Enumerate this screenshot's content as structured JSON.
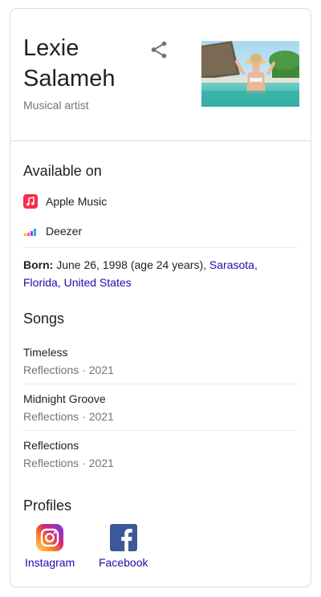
{
  "header": {
    "name": "Lexie Salameh",
    "subtitle": "Musical artist"
  },
  "available_on": {
    "title": "Available on",
    "items": [
      {
        "label": "Apple Music",
        "icon": "apple-music-icon"
      },
      {
        "label": "Deezer",
        "icon": "deezer-icon"
      }
    ]
  },
  "born": {
    "label": "Born:",
    "text": "June 26, 1998 (age 24 years),",
    "place1": "Sarasota,",
    "place2": "Florida,",
    "place3": "United States"
  },
  "songs": {
    "title": "Songs",
    "items": [
      {
        "title": "Timeless",
        "meta": "Reflections · 2021"
      },
      {
        "title": "Midnight Groove",
        "meta": "Reflections · 2021"
      },
      {
        "title": "Reflections",
        "meta": "Reflections · 2021"
      }
    ]
  },
  "profiles": {
    "title": "Profiles",
    "items": [
      {
        "label": "Instagram",
        "icon": "instagram-icon"
      },
      {
        "label": "Facebook",
        "icon": "facebook-icon"
      }
    ]
  },
  "colors": {
    "link": "#1a0dab",
    "muted": "#70757a",
    "apple_music": "#fa2d48",
    "facebook": "#3b5998"
  }
}
